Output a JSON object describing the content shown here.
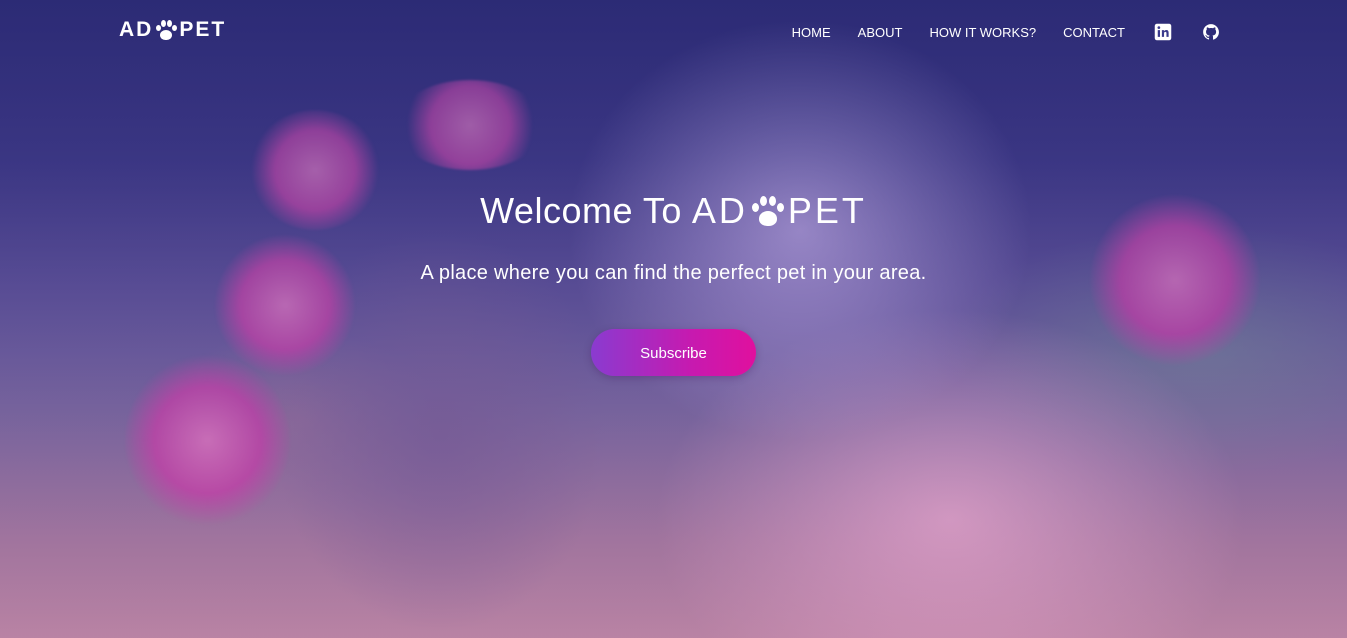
{
  "brand": {
    "logo_prefix": "AD",
    "logo_suffix": "PET",
    "logo_icon": "paw-icon"
  },
  "nav": {
    "links": [
      {
        "label": "HOME"
      },
      {
        "label": "ABOUT"
      },
      {
        "label": "HOW IT WORKS?"
      },
      {
        "label": "CONTACT"
      }
    ],
    "social": [
      {
        "icon": "linkedin-icon"
      },
      {
        "icon": "github-icon"
      }
    ]
  },
  "hero": {
    "title_prefix": "Welcome To",
    "title_brand_prefix": "AD",
    "title_brand_suffix": "PET",
    "subtitle": "A place where you can find the perfect pet in your area.",
    "cta_label": "Subscribe",
    "background": "puppy-and-kitten-photo"
  },
  "colors": {
    "overlay": "#3a3a8c",
    "cta_start": "#8a3bd0",
    "cta_end": "#e0109e",
    "text": "#ffffff"
  }
}
